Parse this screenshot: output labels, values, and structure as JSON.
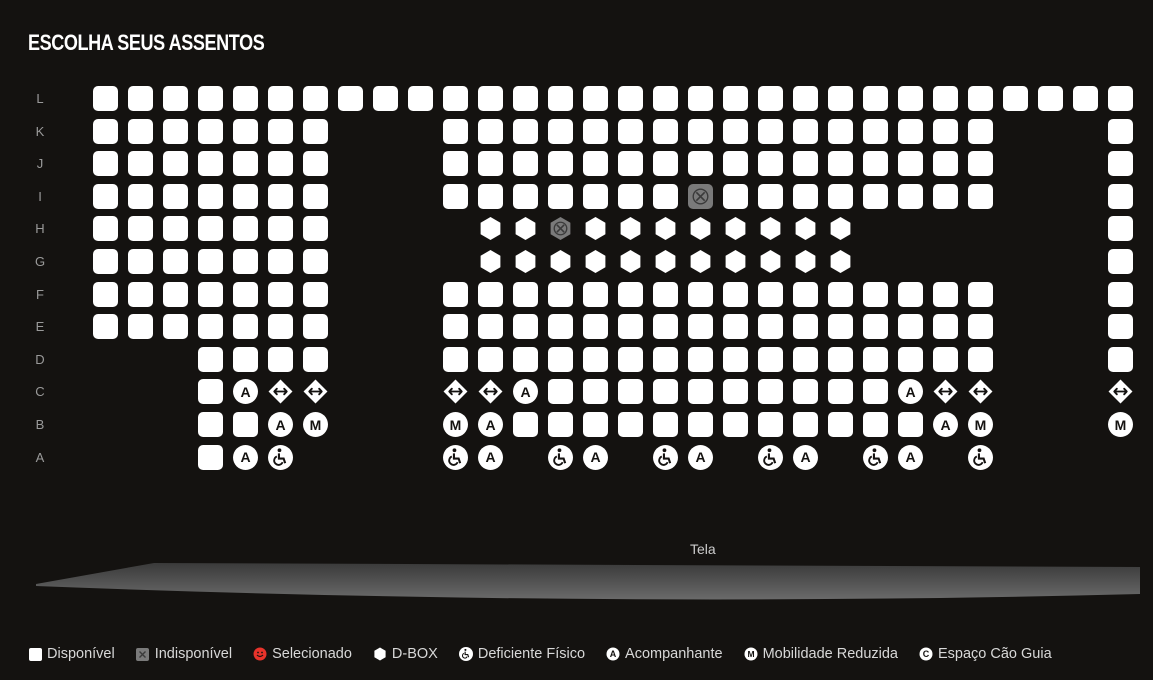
{
  "page": {
    "title": "ESCOLHA SEUS ASSENTOS"
  },
  "colors": {
    "background": "#141210",
    "available": "#ffffff",
    "unavailable": "#7a7a7a",
    "selected": "#e8332b"
  },
  "columns": 30,
  "rows": [
    {
      "label": "L",
      "seats": [
        "S",
        "S",
        "S",
        "S",
        "S",
        "S",
        "S",
        "S",
        "S",
        "S",
        "S",
        "S",
        "S",
        "S",
        "S",
        "S",
        "S",
        "S",
        "S",
        "S",
        "S",
        "S",
        "S",
        "S",
        "S",
        "S",
        "S",
        "S",
        "S",
        "S"
      ]
    },
    {
      "label": "K",
      "seats": [
        "S",
        "S",
        "S",
        "S",
        "S",
        "S",
        "S",
        "",
        "",
        "",
        "S",
        "S",
        "S",
        "S",
        "S",
        "S",
        "S",
        "S",
        "S",
        "S",
        "S",
        "S",
        "S",
        "S",
        "S",
        "S",
        "",
        "",
        "",
        "S"
      ]
    },
    {
      "label": "J",
      "seats": [
        "S",
        "S",
        "S",
        "S",
        "S",
        "S",
        "S",
        "",
        "",
        "",
        "S",
        "S",
        "S",
        "S",
        "S",
        "S",
        "S",
        "S",
        "S",
        "S",
        "S",
        "S",
        "S",
        "S",
        "S",
        "S",
        "",
        "",
        "",
        "S"
      ]
    },
    {
      "label": "I",
      "seats": [
        "S",
        "S",
        "S",
        "S",
        "S",
        "S",
        "S",
        "",
        "",
        "",
        "S",
        "S",
        "S",
        "S",
        "S",
        "S",
        "S",
        "X",
        "S",
        "S",
        "S",
        "S",
        "S",
        "S",
        "S",
        "S",
        "",
        "",
        "",
        "S"
      ]
    },
    {
      "label": "H",
      "seats": [
        "S",
        "S",
        "S",
        "S",
        "S",
        "S",
        "S",
        "",
        "",
        "",
        "",
        "D",
        "D",
        "DX",
        "D",
        "D",
        "D",
        "D",
        "D",
        "D",
        "D",
        "D",
        "",
        "",
        "",
        "",
        "",
        "",
        "",
        "S"
      ]
    },
    {
      "label": "G",
      "seats": [
        "S",
        "S",
        "S",
        "S",
        "S",
        "S",
        "S",
        "",
        "",
        "",
        "",
        "D",
        "D",
        "D",
        "D",
        "D",
        "D",
        "D",
        "D",
        "D",
        "D",
        "D",
        "",
        "",
        "",
        "",
        "",
        "",
        "",
        "S"
      ]
    },
    {
      "label": "F",
      "seats": [
        "S",
        "S",
        "S",
        "S",
        "S",
        "S",
        "S",
        "",
        "",
        "",
        "S",
        "S",
        "S",
        "S",
        "S",
        "S",
        "S",
        "S",
        "S",
        "S",
        "S",
        "S",
        "S",
        "S",
        "S",
        "S",
        "",
        "",
        "",
        "S"
      ]
    },
    {
      "label": "E",
      "seats": [
        "S",
        "S",
        "S",
        "S",
        "S",
        "S",
        "S",
        "",
        "",
        "",
        "S",
        "S",
        "S",
        "S",
        "S",
        "S",
        "S",
        "S",
        "S",
        "S",
        "S",
        "S",
        "S",
        "S",
        "S",
        "S",
        "",
        "",
        "",
        "S"
      ]
    },
    {
      "label": "D",
      "seats": [
        "",
        "",
        "",
        "S",
        "S",
        "S",
        "S",
        "",
        "",
        "",
        "S",
        "S",
        "S",
        "S",
        "S",
        "S",
        "S",
        "S",
        "S",
        "S",
        "S",
        "S",
        "S",
        "S",
        "S",
        "S",
        "",
        "",
        "",
        "S"
      ]
    },
    {
      "label": "C",
      "seats": [
        "",
        "",
        "",
        "S",
        "A",
        "G",
        "G",
        "",
        "",
        "",
        "G",
        "G",
        "A",
        "S",
        "S",
        "S",
        "S",
        "S",
        "S",
        "S",
        "S",
        "S",
        "S",
        "A",
        "G",
        "G",
        "",
        "",
        "",
        "G"
      ]
    },
    {
      "label": "B",
      "seats": [
        "",
        "",
        "",
        "S",
        "S",
        "A",
        "M",
        "",
        "",
        "",
        "M",
        "A",
        "S",
        "S",
        "S",
        "S",
        "S",
        "S",
        "S",
        "S",
        "S",
        "S",
        "S",
        "S",
        "A",
        "M",
        "",
        "",
        "",
        "M"
      ]
    },
    {
      "label": "A",
      "seats": [
        "",
        "",
        "",
        "S",
        "A",
        "W",
        "",
        "",
        "",
        "",
        "W",
        "A",
        "",
        "W",
        "A",
        "",
        "W",
        "A",
        "",
        "W",
        "A",
        "",
        "W",
        "A",
        "",
        "W",
        "",
        "",
        "",
        ""
      ]
    }
  ],
  "screen": {
    "label": "Tela"
  },
  "legend": [
    {
      "key": "available",
      "label": "Disponível"
    },
    {
      "key": "unavailable",
      "label": "Indisponível"
    },
    {
      "key": "selected",
      "label": "Selecionado"
    },
    {
      "key": "dbox",
      "label": "D-BOX"
    },
    {
      "key": "wheelchair",
      "label": "Deficiente Físico"
    },
    {
      "key": "companion",
      "label": "Acompanhante"
    },
    {
      "key": "reduced",
      "label": "Mobilidade Reduzida"
    },
    {
      "key": "guidedog",
      "label": "Espaço Cão Guia"
    }
  ],
  "icons": {
    "A": "A",
    "M": "M",
    "C": "C"
  }
}
